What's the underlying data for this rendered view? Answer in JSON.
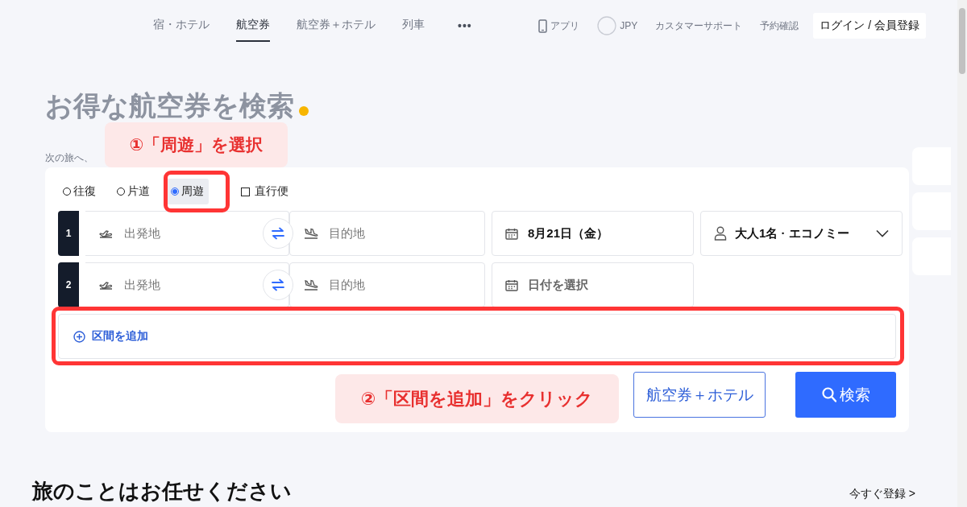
{
  "nav": {
    "tabs": [
      {
        "label": "宿・ホテル",
        "selected": false
      },
      {
        "label": "航空券",
        "selected": true
      },
      {
        "label": "航空券＋ホテル",
        "selected": false
      },
      {
        "label": "列車",
        "selected": false
      }
    ],
    "more": "•••",
    "links": [
      {
        "kind": "app",
        "label": "アプリ"
      },
      {
        "kind": "currency",
        "label": "JPY"
      },
      {
        "kind": "text",
        "label": "カスタマーサポート"
      },
      {
        "kind": "text",
        "label": "予約確認"
      }
    ],
    "login": "ログイン / 会員登録"
  },
  "hero": {
    "title": "お得な航空券を検索",
    "subtitle": "次の旅へ、"
  },
  "trip_types": [
    {
      "label": "往復",
      "selected": false
    },
    {
      "label": "片道",
      "selected": false
    },
    {
      "label": "周遊",
      "selected": true
    }
  ],
  "direct_flight": {
    "label": "直行便",
    "checked": false
  },
  "segments": [
    {
      "number": "1",
      "from_placeholder": "出発地",
      "to_placeholder": "目的地",
      "date": "8月21日（金）"
    },
    {
      "number": "2",
      "from_placeholder": "出発地",
      "to_placeholder": "目的地",
      "date_placeholder": "日付を選択"
    }
  ],
  "passengers": "大人1名 · エコノミー",
  "add_segment": "区間を追加",
  "buttons": [
    {
      "kind": "secondary",
      "label": "航空券＋ホテル"
    },
    {
      "kind": "primary",
      "label": "検索"
    }
  ],
  "annotations": [
    {
      "text": "①「周遊」を選択"
    },
    {
      "text": "②「区間を追加」をクリック"
    }
  ],
  "section": {
    "title": "旅のことはお任せください",
    "link": "今すぐ登録 >"
  }
}
